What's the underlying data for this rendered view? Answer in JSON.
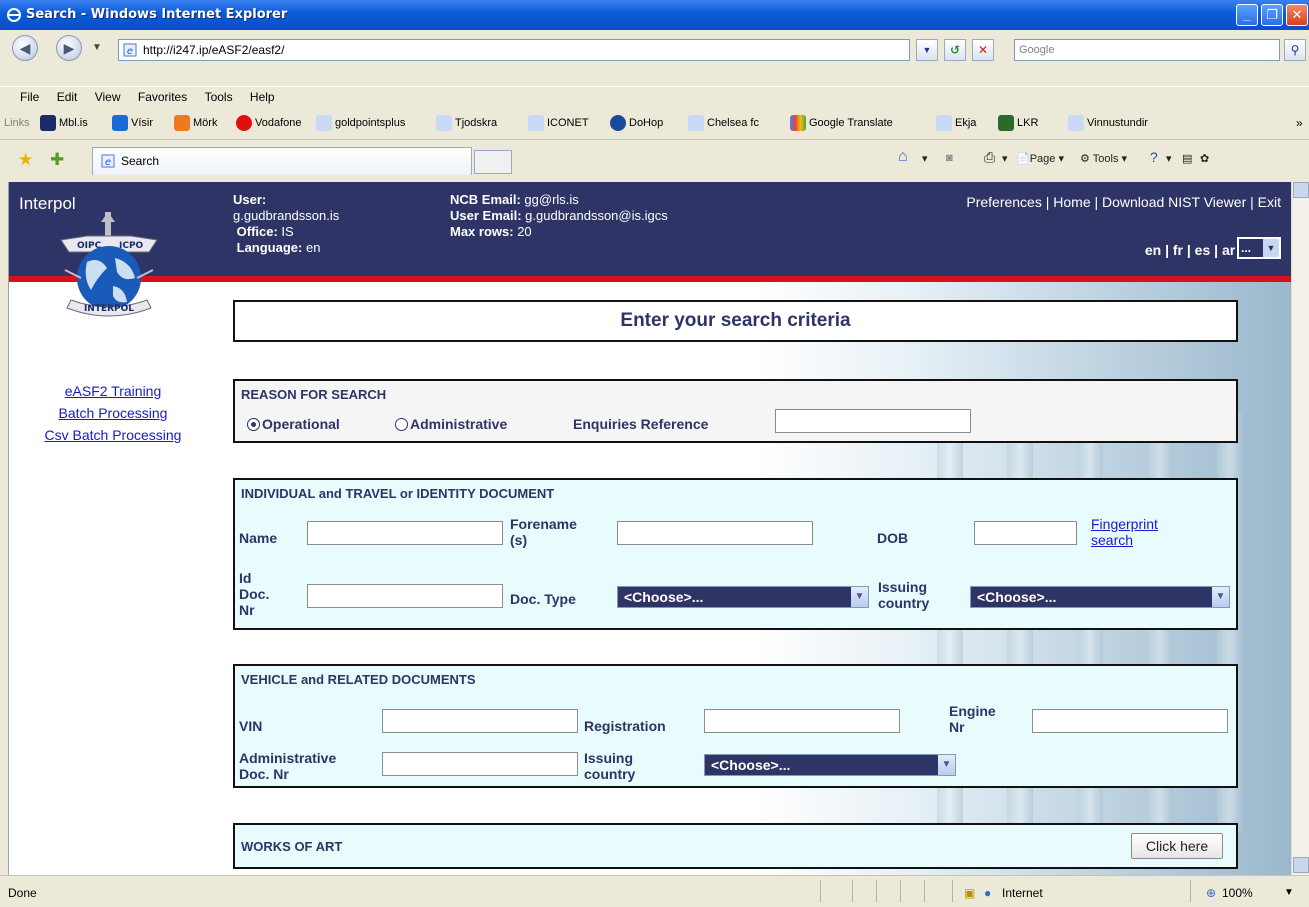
{
  "window": {
    "title": "Search - Windows Internet Explorer"
  },
  "address": {
    "url": "http://i247.ip/eASF2/easf2/",
    "search_placeholder": "Google"
  },
  "menu": [
    "File",
    "Edit",
    "View",
    "Favorites",
    "Tools",
    "Help"
  ],
  "links_label": "Links",
  "links": [
    "Mbl.is",
    "Vísir",
    "Mörk",
    "Vodafone",
    "goldpointsplus",
    "Tjodskra",
    "ICONET",
    "DoHop",
    "Chelsea fc",
    "Google Translate",
    "Ekja",
    "LKR",
    "Vinnustundir"
  ],
  "tab": {
    "label": "Search"
  },
  "commands": {
    "page": "Page",
    "tools": "Tools"
  },
  "header": {
    "logo_text": "Interpol",
    "user_label": "User:",
    "user_value": "g.gudbrandsson.is",
    "office_label": "Office:",
    "office_value": "IS",
    "language_label": "Language:",
    "language_value": "en",
    "ncb_email_label": "NCB Email:",
    "ncb_email_value": "gg@rls.is",
    "user_email_label": "User Email:",
    "user_email_value": "g.gudbrandsson@is.igcs",
    "max_rows_label": "Max rows:",
    "max_rows_value": "20",
    "nav_links": "Preferences | Home | Download NIST Viewer | Exit",
    "languages": "en | fr | es | ar |",
    "lang_select": "..."
  },
  "sidebar": [
    "eASF2 Training",
    "Batch Processing",
    "Csv Batch Processing"
  ],
  "main": {
    "heading": "Enter your search criteria",
    "reason": {
      "title": "REASON FOR SEARCH",
      "operational": "Operational",
      "administrative": "Administrative",
      "enquiries_label": "Enquiries Reference",
      "selected": "Operational"
    },
    "individual": {
      "title": "INDIVIDUAL and TRAVEL or IDENTITY DOCUMENT",
      "name": "Name",
      "forename_1": "Forename",
      "forename_2": "(s)",
      "dob": "DOB",
      "fingerprint_1": "Fingerprint",
      "fingerprint_2": "search",
      "id_1": "Id",
      "id_2": "Doc.",
      "id_3": "Nr",
      "doc_type": "Doc. Type",
      "doc_type_value": "<Choose>...",
      "issuing_1": "Issuing",
      "issuing_2": "country",
      "issuing_value": "<Choose>..."
    },
    "vehicle": {
      "title": "VEHICLE and RELATED DOCUMENTS",
      "vin": "VIN",
      "registration": "Registration",
      "engine_1": "Engine",
      "engine_2": "Nr",
      "admin_1": "Administrative",
      "admin_2": "Doc. Nr",
      "issuing_1": "Issuing",
      "issuing_2": "country",
      "issuing_value": "<Choose>..."
    },
    "art": {
      "title": "WORKS OF ART",
      "button": "Click here"
    }
  },
  "status": {
    "text": "Done",
    "zone": "Internet",
    "zoom": "100%"
  }
}
